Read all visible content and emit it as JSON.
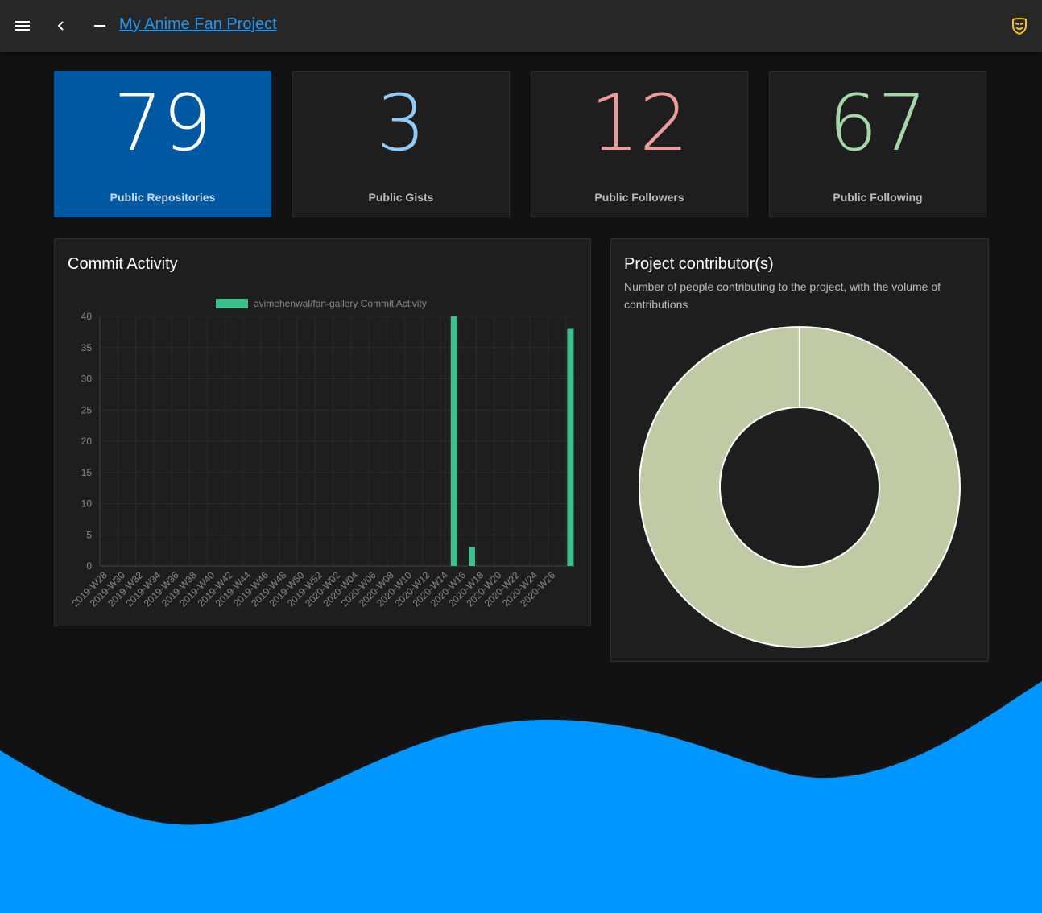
{
  "appbar": {
    "title": "My Anime Fan Project",
    "icons": [
      "menu-icon",
      "chevron-left-icon",
      "minus-icon",
      "mask-icon"
    ],
    "accent": "#2196f3",
    "badge_color": "#f5c518"
  },
  "stats": [
    {
      "value": "79",
      "label": "Public Repositories",
      "color": "#ffffff",
      "bg": "#0158a2"
    },
    {
      "value": "3",
      "label": "Public Gists",
      "color": "#90caf9"
    },
    {
      "value": "12",
      "label": "Public Followers",
      "color": "#ef9a9a"
    },
    {
      "value": "67",
      "label": "Public Following",
      "color": "#a5d6a7"
    }
  ],
  "commit_card": {
    "title": "Commit Activity"
  },
  "contrib_card": {
    "title": "Project contributor(s)",
    "subtitle": "Number of people contributing to the project, with the volume of contributions"
  },
  "chart_data": [
    {
      "type": "bar",
      "title": "",
      "series": [
        {
          "name": "avimehenwal/fan-gallery Commit Activity",
          "color": "#3ebf8b",
          "values": [
            0,
            0,
            0,
            0,
            0,
            0,
            0,
            0,
            0,
            0,
            0,
            0,
            0,
            0,
            0,
            0,
            0,
            0,
            0,
            0,
            0,
            0,
            0,
            0,
            0,
            0,
            0,
            0,
            0,
            0,
            0,
            0,
            0,
            0,
            0,
            0,
            0,
            0,
            0,
            40,
            0,
            3,
            0,
            0,
            0,
            0,
            0,
            0,
            0,
            0,
            0,
            0,
            38
          ]
        }
      ],
      "tick_labels": [
        "2019-W28",
        "2019-W30",
        "2019-W32",
        "2019-W34",
        "2019-W36",
        "2019-W38",
        "2019-W40",
        "2019-W42",
        "2019-W44",
        "2019-W46",
        "2019-W48",
        "2019-W50",
        "2019-W52",
        "2020-W02",
        "2020-W04",
        "2020-W06",
        "2020-W08",
        "2020-W10",
        "2020-W12",
        "2020-W14",
        "2020-W16",
        "2020-W18",
        "2020-W20",
        "2020-W22",
        "2020-W24",
        "2020-W26"
      ],
      "ylim": [
        0,
        40
      ],
      "yticks": [
        0,
        5,
        10,
        15,
        20,
        25,
        30,
        35,
        40
      ],
      "grid": true,
      "legend": "top"
    },
    {
      "type": "pie",
      "subtype": "doughnut",
      "values": [
        99.99,
        0.01
      ],
      "colors": [
        "#c0cba5",
        "#c0cba5"
      ],
      "legend": "none"
    }
  ],
  "background": {
    "wave_color": "#0096ff"
  }
}
